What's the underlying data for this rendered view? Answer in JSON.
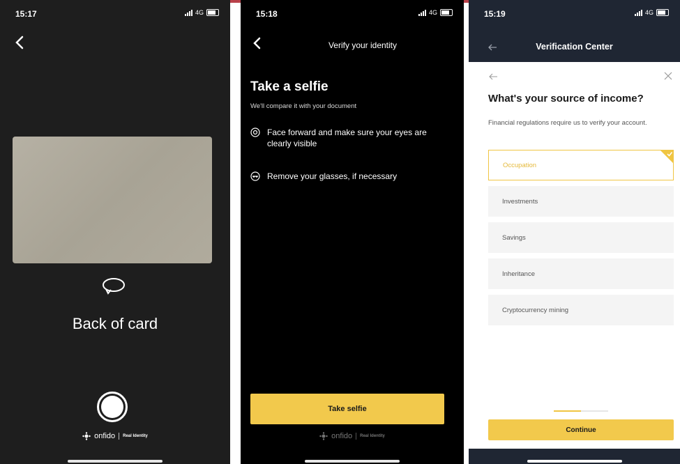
{
  "colors": {
    "accent_yellow": "#f2c94c",
    "selected_border": "#f0c542",
    "dark_bar": "#1f2633",
    "card": "#b0ab9d"
  },
  "phone1": {
    "status": {
      "time": "15:17",
      "network": "4G"
    },
    "icons": {
      "back": "chevron-left-icon",
      "rotate": "rotate-icon",
      "shutter": "camera-shutter-icon"
    },
    "title": "Back of card",
    "branding": {
      "name": "onfido",
      "tagline": "Real Identity"
    }
  },
  "phone2": {
    "status": {
      "time": "15:18",
      "network": "4G"
    },
    "header": "Verify your identity",
    "heading": "Take a selfie",
    "subheading": "We'll compare it with your document",
    "instructions": [
      {
        "icon": "face-icon",
        "text": "Face forward and make sure your eyes are clearly visible"
      },
      {
        "icon": "glasses-icon",
        "text": "Remove your glasses, if necessary"
      }
    ],
    "button": "Take selfie",
    "branding": {
      "name": "onfido",
      "tagline": "Real Identity"
    }
  },
  "phone3": {
    "status": {
      "time": "15:19",
      "network": "4G"
    },
    "header": "Verification Center",
    "question": "What's your source of income?",
    "description": "Financial regulations require us to verify your account.",
    "options": [
      {
        "label": "Occupation",
        "selected": true
      },
      {
        "label": "Investments",
        "selected": false
      },
      {
        "label": "Savings",
        "selected": false
      },
      {
        "label": "Inheritance",
        "selected": false
      },
      {
        "label": "Cryptocurrency mining",
        "selected": false
      }
    ],
    "progress": 0.5,
    "button": "Continue"
  }
}
